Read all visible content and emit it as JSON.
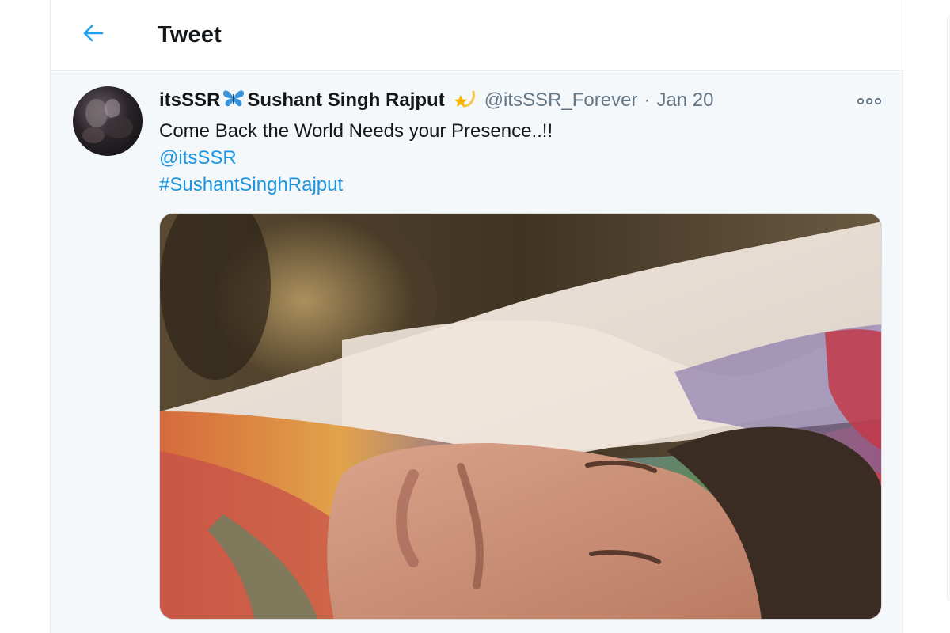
{
  "header": {
    "title": "Tweet",
    "back_icon": "arrow-left-icon",
    "accent_color": "#1da1f2"
  },
  "tweet": {
    "name_prefix": "itsSSR",
    "name_emoji": "butterfly-icon",
    "display_name": "Sushant Singh Rajput",
    "name_badge": "shooting-star-icon",
    "handle": "@itsSSR_Forever",
    "separator": "·",
    "date": "Jan 20",
    "text": "Come Back the World Needs your Presence..!!",
    "mention": "@itsSSR",
    "hashtag": "#SushantSinghRajput",
    "more_icon": "more-options-icon",
    "link_color": "#1b95e0"
  }
}
